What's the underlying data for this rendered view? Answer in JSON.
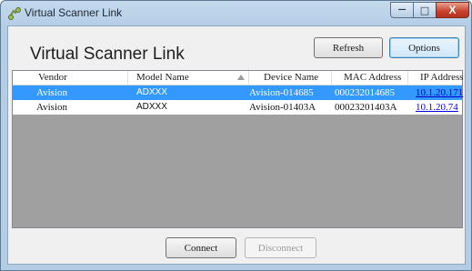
{
  "window": {
    "title": "Virtual Scanner Link",
    "min_symbol": "—",
    "max_symbol": "□",
    "close_symbol": "X"
  },
  "header": {
    "title": "Virtual Scanner Link",
    "refresh_label": "Refresh",
    "options_label": "Options"
  },
  "table": {
    "columns": [
      "Vendor",
      "Model Name",
      "Device Name",
      "MAC Address",
      "IP Address"
    ],
    "sort_icon": "sort-ascending-icon",
    "rows": [
      {
        "vendor": "Avision",
        "model": "ADXXX",
        "device": "Avision-014685",
        "mac": "000232014685",
        "ip": "10.1.20.171",
        "selected": true
      },
      {
        "vendor": "Avision",
        "model": "ADXXX",
        "device": "Avision-01403A",
        "mac": "00023201403A",
        "ip": "10.1.20.74",
        "selected": false
      }
    ]
  },
  "footer": {
    "connect_label": "Connect",
    "disconnect_label": "Disconnect"
  },
  "colors": {
    "selection": "#3399ff",
    "link": "#0000ee",
    "list_background": "#a0a0a0"
  }
}
